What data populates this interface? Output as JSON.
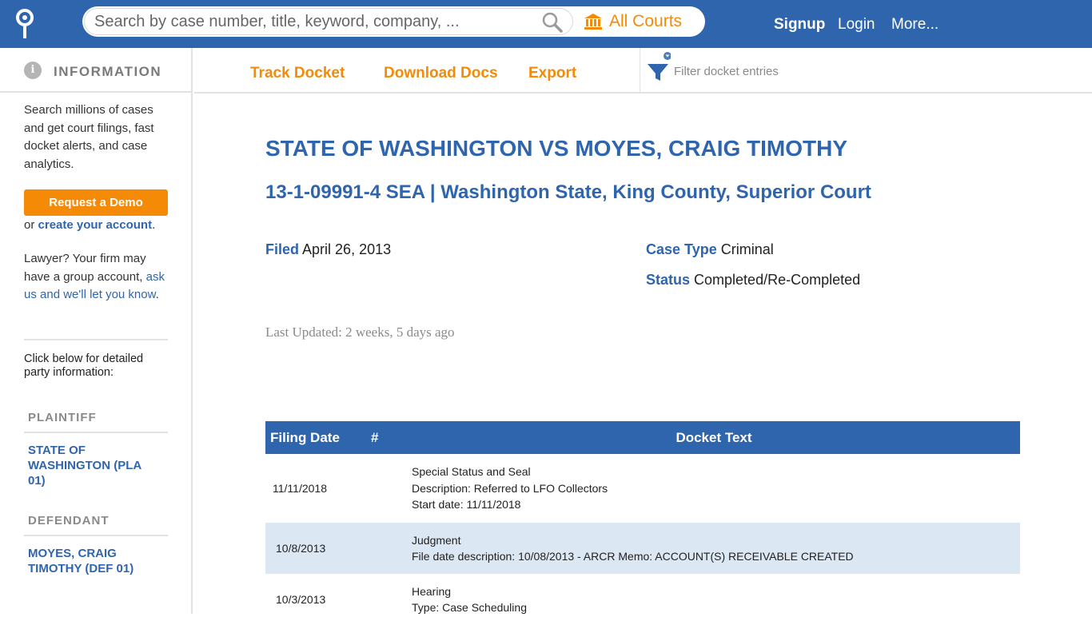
{
  "header": {
    "logo_icon": "docket-logo-icon",
    "search_placeholder": "Search by case number, title, keyword, company, ...",
    "search_icon": "search-icon",
    "courts_icon": "courthouse-icon",
    "courts_label": "All Courts",
    "nav": {
      "signup": "Signup",
      "login": "Login",
      "more": "More..."
    }
  },
  "sidebar": {
    "heading": "INFORMATION",
    "intro": "Search millions of cases and get court filings, fast docket alerts, and case analytics.",
    "demo_button": "Request a Demo",
    "or_text": "or",
    "create_account_link": "create your account",
    "lawyer_text": "Lawyer? Your firm may have a group account,",
    "ask_link": "ask us and we'll let you know",
    "party_prompt": "Click below for detailed party information:",
    "plaintiff_heading": "PLAINTIFF",
    "plaintiff": "STATE OF WASHINGTON (PLA 01)",
    "defendant_heading": "DEFENDANT",
    "defendant": "MOYES, CRAIG TIMOTHY (DEF 01)"
  },
  "toolbar": {
    "track_docket": "Track Docket",
    "download_docs": "Download Docs",
    "export": "Export",
    "filter_icon": "filter-funnel-icon",
    "filter_placeholder": "Filter docket entries"
  },
  "case": {
    "title": "STATE OF WASHINGTON VS MOYES, CRAIG TIMOTHY",
    "subtitle": "13-1-09991-4 SEA | Washington State, King County, Superior Court",
    "filed_label": "Filed",
    "filed_value": "April 26, 2013",
    "case_type_label": "Case Type",
    "case_type_value": "Criminal",
    "status_label": "Status",
    "status_value": "Completed/Re-Completed",
    "last_updated": "Last Updated: 2 weeks, 5 days ago"
  },
  "docket": {
    "columns": [
      "Filing Date",
      "#",
      "Docket Text"
    ],
    "rows": [
      {
        "date": "11/11/2018",
        "num": "",
        "lines": [
          "Special Status and Seal",
          "Description: Referred to LFO Collectors",
          "Start date: 11/11/2018"
        ]
      },
      {
        "date": "10/8/2013",
        "num": "",
        "lines": [
          "Judgment",
          "File date description: 10/08/2013 - ARCR Memo: ACCOUNT(S) RECEIVABLE CREATED"
        ]
      },
      {
        "date": "10/3/2013",
        "num": "",
        "lines": [
          "Hearing",
          "Type: Case Scheduling"
        ]
      }
    ]
  },
  "colors": {
    "brand_blue": "#2f65ad",
    "accent_orange": "#f58a07",
    "row_alt": "#dce7f4"
  }
}
